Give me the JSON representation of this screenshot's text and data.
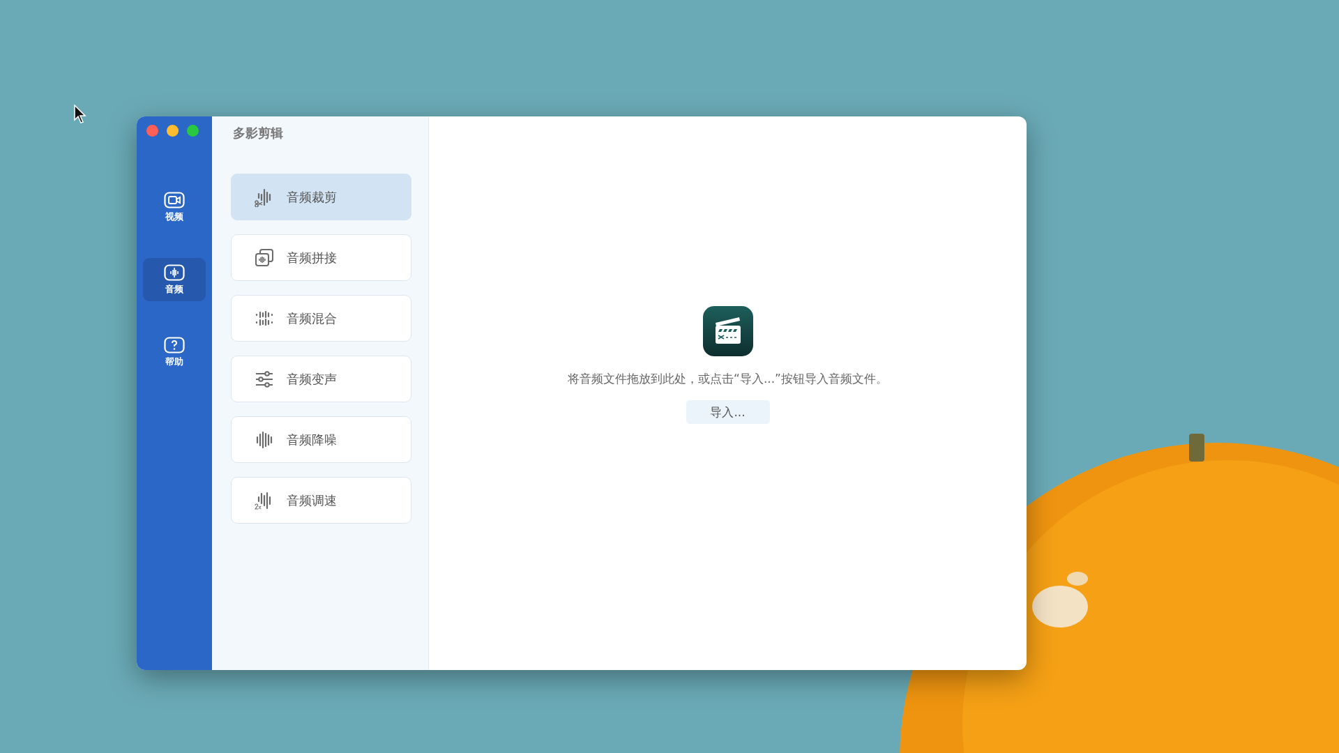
{
  "window": {
    "title": "多影剪辑"
  },
  "nav": [
    {
      "label": "视频",
      "selected": false
    },
    {
      "label": "音频",
      "selected": true
    },
    {
      "label": "帮助",
      "selected": false
    }
  ],
  "tools": [
    {
      "label": "音频裁剪",
      "selected": true
    },
    {
      "label": "音频拼接",
      "selected": false
    },
    {
      "label": "音频混合",
      "selected": false
    },
    {
      "label": "音频变声",
      "selected": false
    },
    {
      "label": "音频降噪",
      "selected": false
    },
    {
      "label": "音频调速",
      "selected": false
    }
  ],
  "drop_hint": "将音频文件拖放到此处，或点击“导入...”按钮导入音频文件。",
  "import_button": "导入..."
}
